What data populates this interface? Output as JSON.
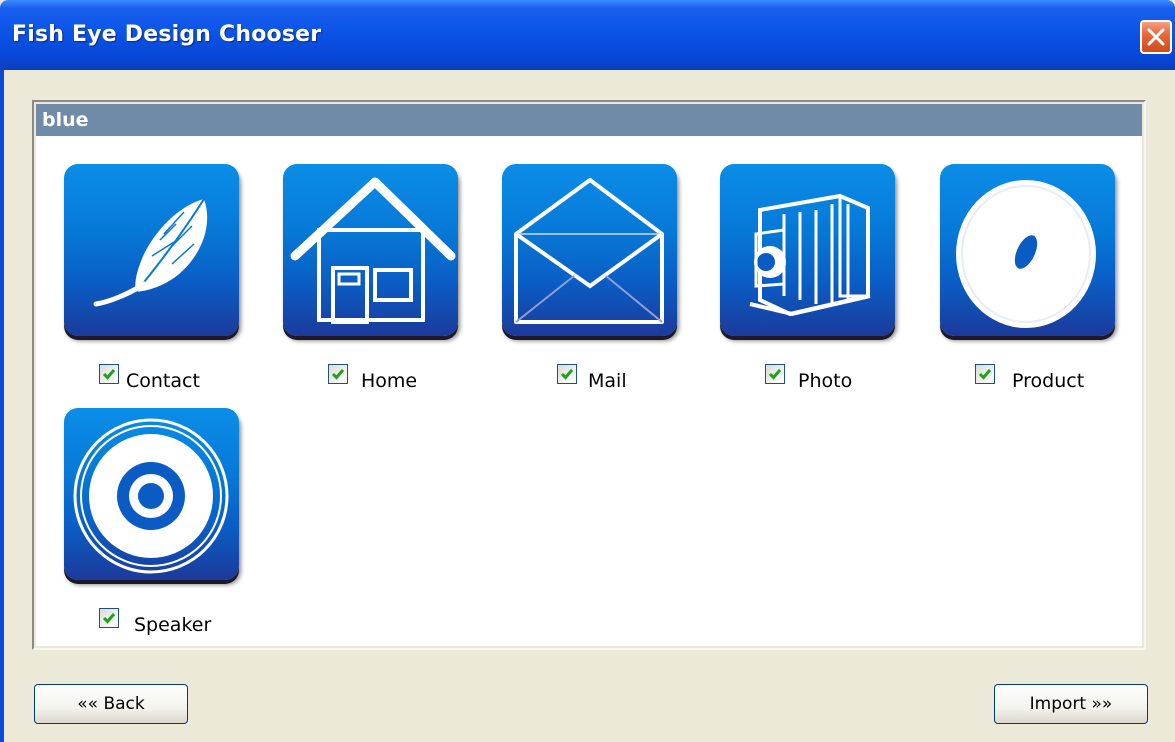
{
  "window": {
    "title": "Fish Eye Design Chooser"
  },
  "group": {
    "name": "blue"
  },
  "items": [
    {
      "label": "Contact",
      "icon": "feather-icon",
      "checked": true
    },
    {
      "label": "Home",
      "icon": "house-icon",
      "checked": true
    },
    {
      "label": "Mail",
      "icon": "envelope-icon",
      "checked": true
    },
    {
      "label": "Photo",
      "icon": "camera-icon",
      "checked": true
    },
    {
      "label": "Product",
      "icon": "disc-icon",
      "checked": true
    },
    {
      "label": "Speaker",
      "icon": "speaker-icon",
      "checked": true
    }
  ],
  "buttons": {
    "back_label": "«« Back",
    "import_label": "Import »»"
  },
  "colors": {
    "titlebar": "#0a54e6",
    "group_header": "#6f8ba8",
    "tile": "#0678d6",
    "check": "#21a121"
  }
}
